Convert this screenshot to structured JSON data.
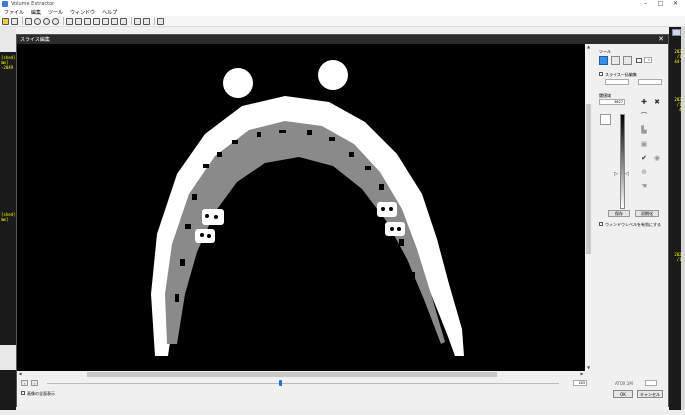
{
  "app": {
    "title": "Volume Extractor"
  },
  "window_controls": {
    "minimize": "–",
    "maximize": "□",
    "close": "✕"
  },
  "menu": [
    "ファイル",
    "編集",
    "ツール",
    "ウィンドウ",
    "ヘルプ"
  ],
  "background": {
    "left_labels": [
      "[shed]",
      "mm]",
      "-2049"
    ],
    "left_labels_2": [
      "[shed]",
      "mm]"
    ],
    "right_labels_1": [
      "2024",
      "/19",
      "44-6"
    ],
    "right_labels_2": [
      "2024",
      "/19",
      "4W"
    ],
    "right_labels_3": [
      "2024",
      "/19"
    ]
  },
  "dialog": {
    "title": "スライス編集",
    "close": "✕",
    "panel": {
      "tool_label": "ツール",
      "brush_size": "0",
      "slice_link_label": "スライス一括編集",
      "slice_from": "",
      "slice_to": "",
      "threshold_label": "閾値域",
      "threshold_value": "3627",
      "save_button": "保存",
      "init_button": "初期化",
      "window_level_label": "ウィンドウレベルを有効にする"
    },
    "footer": {
      "show_all_label": "画像の全面表示",
      "slice_value": "183",
      "status_text": "ATOX 2M",
      "ok": "OK",
      "cancel": "キャンセル"
    }
  }
}
